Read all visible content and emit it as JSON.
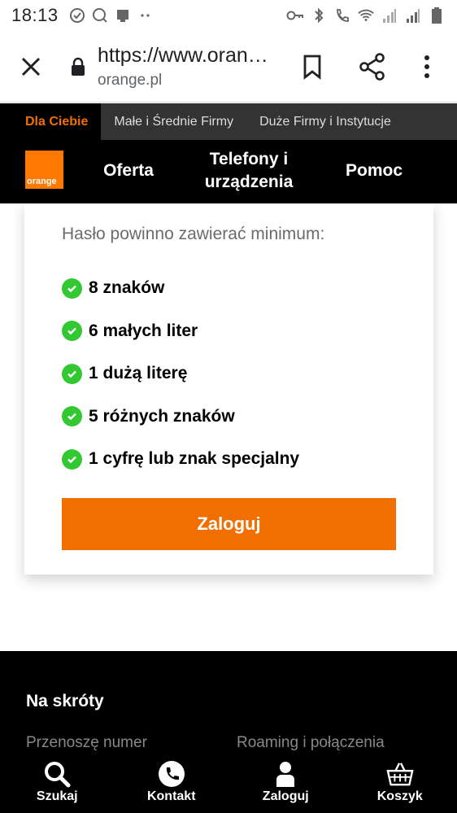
{
  "status_bar": {
    "time": "18:13",
    "icons_left": [
      "check-circle-icon",
      "search-badge-icon",
      "image-icon",
      "more-dots-icon"
    ],
    "icons_right": [
      "key-icon",
      "bluetooth-icon",
      "wifi-call-icon",
      "wifi-icon",
      "signal-icon",
      "signal-icon",
      "battery-icon"
    ]
  },
  "url_bar": {
    "url": "https://www.oran…",
    "domain": "orange.pl"
  },
  "segments": [
    {
      "label": "Dla Ciebie",
      "active": true
    },
    {
      "label": "Małe i Średnie Firmy",
      "active": false
    },
    {
      "label": "Duże Firmy i Instytucje",
      "active": false
    }
  ],
  "main_nav": {
    "logo_text": "orange",
    "items": [
      "Oferta",
      "Telefony i urządzenia",
      "Pomoc"
    ]
  },
  "card": {
    "title": "Hasło powinno zawierać minimum:",
    "requirements": [
      "8 znaków",
      "6 małych liter",
      "1 dużą literę",
      "5 różnych znaków",
      "1 cyfrę lub znak specjalny"
    ],
    "button": "Zaloguj"
  },
  "footer": {
    "heading": "Na skróty",
    "links": [
      "Przenoszę numer",
      "Roaming i połączenia"
    ]
  },
  "bottom_bar": [
    {
      "label": "Szukaj",
      "icon": "search-icon"
    },
    {
      "label": "Kontakt",
      "icon": "phone-icon"
    },
    {
      "label": "Zaloguj",
      "icon": "user-icon"
    },
    {
      "label": "Koszyk",
      "icon": "basket-icon"
    }
  ],
  "colors": {
    "accent": "#f16e00",
    "check": "#32c832",
    "nav_bg": "#000000",
    "segment_bg": "#333333"
  }
}
